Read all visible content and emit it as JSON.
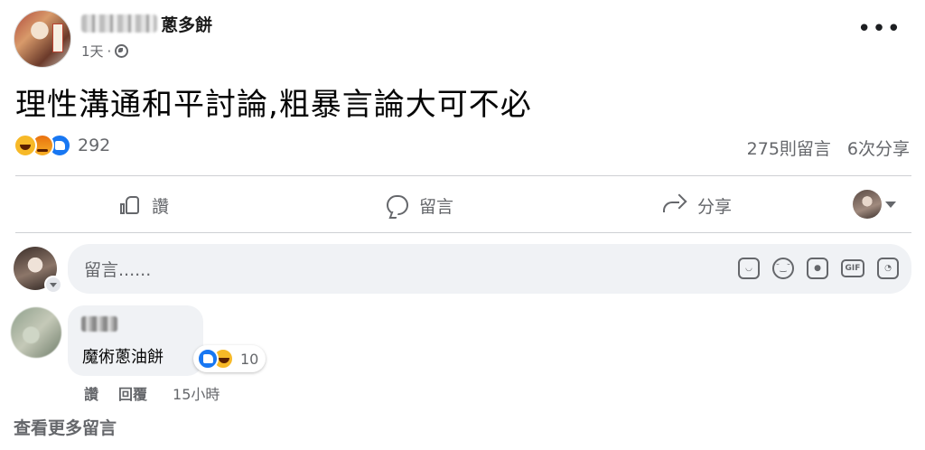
{
  "post": {
    "author_name_visible": "蔥多餅",
    "time": "1天",
    "separator": "·",
    "text": "理性溝通和平討論,粗暴言論大可不必",
    "more_menu": "•••",
    "reaction_count": "292",
    "comment_count": "275則留言",
    "share_count": "6次分享",
    "reactions": [
      "haha-icon",
      "angry-icon",
      "like-icon"
    ]
  },
  "actions": {
    "like_label": "讚",
    "comment_label": "留言",
    "share_label": "分享"
  },
  "composer": {
    "placeholder": "留言......",
    "tools": [
      "sticker-icon",
      "emoji-icon",
      "camera-icon",
      "gif-icon",
      "avatar-sticker-icon"
    ],
    "gif_label": "GIF"
  },
  "comments": [
    {
      "text": "魔術蔥油餅",
      "reaction_count": "10",
      "reactions": [
        "like-icon",
        "haha-icon"
      ],
      "like_label": "讚",
      "reply_label": "回覆",
      "time": "15小時"
    }
  ],
  "view_more": "查看更多留言",
  "colors": {
    "text": "#050505",
    "secondary": "#65676b",
    "divider": "#ced0d4",
    "input_bg": "#f0f2f5",
    "like_blue": "#1877f2",
    "haha_yellow": "#f7b928"
  }
}
